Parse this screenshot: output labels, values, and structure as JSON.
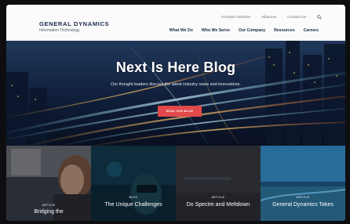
{
  "brand": {
    "name": "GENERAL DYNAMICS",
    "subtitle": "Information Technology"
  },
  "utility_nav": [
    "Contract Vehicles",
    "Alliances",
    "Contact Us"
  ],
  "main_nav": [
    "What We Do",
    "Who We Serve",
    "Our Company",
    "Resources",
    "Careers"
  ],
  "hero": {
    "title": "Next Is Here Blog",
    "subtitle": "Our thought leaders discuss the latest industry news and innovations.",
    "cta": "READ OUR BLOG"
  },
  "cards": [
    {
      "tag": "ARTICLE",
      "title": "Bridging the"
    },
    {
      "tag": "BLOG",
      "title": "The Unique Challenges"
    },
    {
      "tag": "ARTICLE",
      "title": "Do Spectre and Meltdown"
    },
    {
      "tag": "ARTICLE",
      "title": "General Dynamics Takes"
    }
  ],
  "icons": {
    "search": "search-icon"
  },
  "colors": {
    "accent": "#e2494a",
    "navy": "#1b2a4a"
  }
}
